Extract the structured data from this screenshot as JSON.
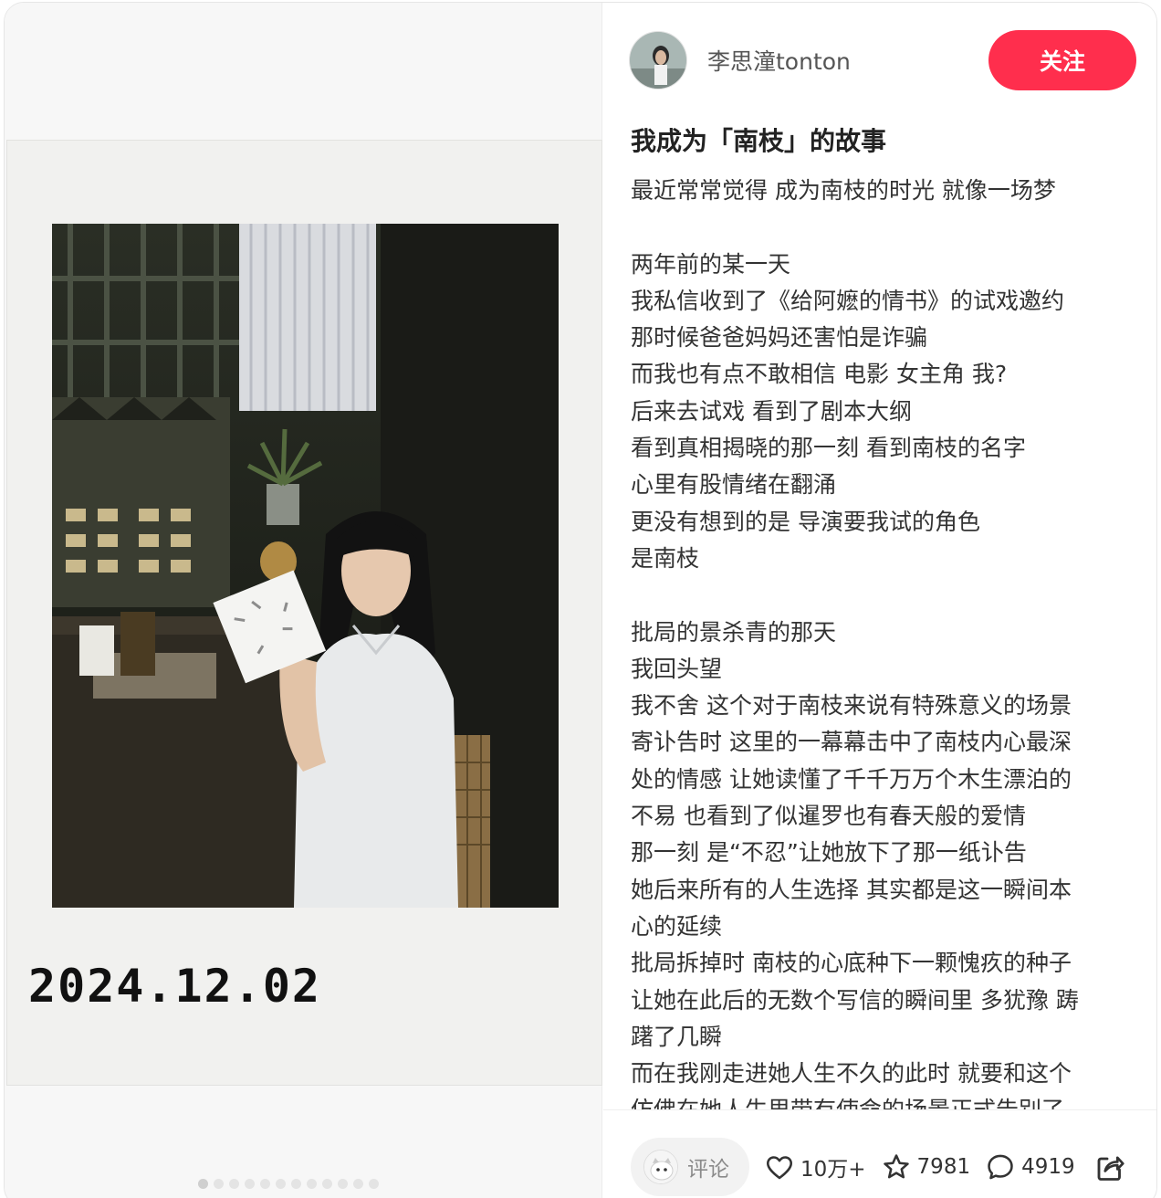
{
  "media": {
    "date_stamp": "2024.12.02",
    "carousel_count": 12,
    "carousel_active_index": 0
  },
  "author": {
    "name": "李思潼tonton",
    "follow_label": "关注"
  },
  "post": {
    "title": "我成为「南枝」的故事",
    "lines": [
      "最近常常觉得 成为南枝的时光 就像一场梦",
      "",
      "两年前的某一天",
      "我私信收到了《给阿嬷的情书》的试戏邀约",
      "那时候爸爸妈妈还害怕是诈骗",
      "而我也有点不敢相信 电影 女主角 我?",
      "后来去试戏 看到了剧本大纲",
      "看到真相揭晓的那一刻 看到南枝的名字",
      "心里有股情绪在翻涌",
      "更没有想到的是 导演要我试的角色",
      "是南枝",
      "",
      "批局的景杀青的那天",
      "我回头望",
      "我不舍 这个对于南枝来说有特殊意义的场景",
      "寄讣告时 这里的一幕幕击中了南枝内心最深",
      "处的情感 让她读懂了千千万万个木生漂泊的",
      "不易 也看到了似暹罗也有春天般的爱情",
      "那一刻 是“不忍”让她放下了那一纸讣告",
      "她后来所有的人生选择 其实都是这一瞬间本",
      "心的延续",
      "批局拆掉时 南枝的心底种下一颗愧疚的种子",
      "让她在此后的无数个写信的瞬间里 多犹豫 踌",
      "躇了几瞬",
      "而在我刚走进她人生不久的此时 就要和这个",
      "仿佛在她人生里带有使命的场景正式告别了"
    ]
  },
  "bottom_bar": {
    "comment_placeholder": "评论",
    "likes": "10万+",
    "collects": "7981",
    "comments": "4919"
  },
  "colors": {
    "accent": "#ff2e4d",
    "text": "#333333",
    "muted": "#8a8a8a"
  }
}
